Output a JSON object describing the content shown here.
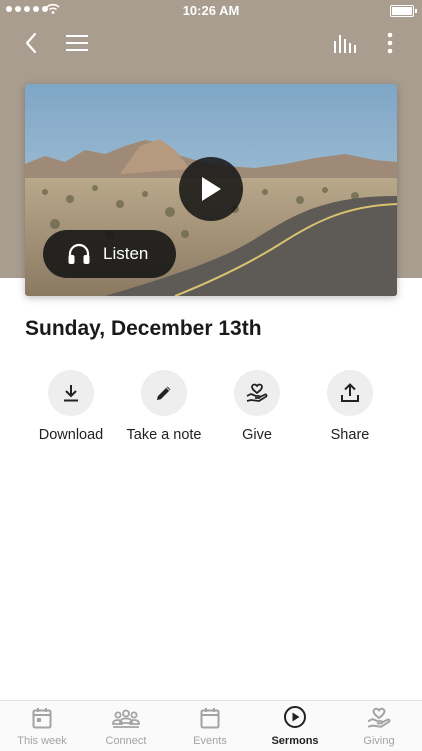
{
  "status_bar": {
    "time": "10:26 AM",
    "signal_icon": "signal-dots-icon",
    "wifi_icon": "wifi-icon",
    "battery_icon": "battery-icon"
  },
  "nav": {
    "back_icon": "chevron-left-icon",
    "menu_icon": "hamburger-menu-icon",
    "audio_icon": "equalizer-icon",
    "more_icon": "more-vertical-icon"
  },
  "media": {
    "image": "desert-road-image",
    "play_icon": "play-icon",
    "listen_label": "Listen",
    "listen_icon": "headphones-icon"
  },
  "page": {
    "title": "Sunday, December 13th"
  },
  "actions": [
    {
      "label": "Download",
      "icon": "download-icon"
    },
    {
      "label": "Take a note",
      "icon": "pencil-icon"
    },
    {
      "label": "Give",
      "icon": "heart-hand-icon"
    },
    {
      "label": "Share",
      "icon": "share-icon"
    }
  ],
  "tabs": [
    {
      "label": "This week",
      "icon": "calendar-icon",
      "active": false
    },
    {
      "label": "Connect",
      "icon": "people-icon",
      "active": false
    },
    {
      "label": "Events",
      "icon": "calendar-icon",
      "active": false
    },
    {
      "label": "Sermons",
      "icon": "play-circle-icon",
      "active": true
    },
    {
      "label": "Giving",
      "icon": "heart-hand-icon",
      "active": false
    }
  ],
  "colors": {
    "header_bg": "#a99d8f",
    "active_tab": "#222222",
    "inactive_tab": "#a3a3a3",
    "action_circle": "#eeeeee"
  }
}
